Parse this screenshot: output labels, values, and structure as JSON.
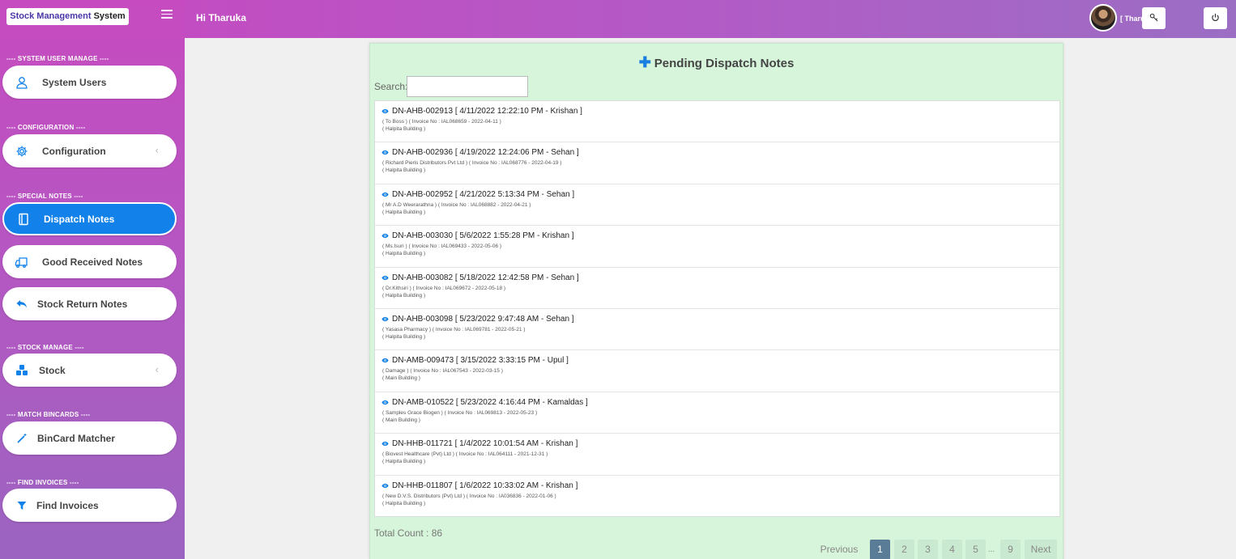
{
  "app": {
    "brand_part1": "Stock Management",
    "brand_part2": "System",
    "greeting": "Hi Tharuka",
    "username": "[ TharukaD ]"
  },
  "sidebar": {
    "sections": [
      {
        "title": "---- SYSTEM USER MANAGE ----"
      },
      {
        "title": "---- CONFIGURATION ----"
      },
      {
        "title": "---- SPECIAL NOTES ----"
      },
      {
        "title": "---- STOCK MANAGE ----"
      },
      {
        "title": "---- MATCH BINCARDS ----"
      },
      {
        "title": "---- FIND INVOICES ----"
      }
    ],
    "items": [
      {
        "label": "System Users",
        "icon": "user-icon"
      },
      {
        "label": "Configuration",
        "icon": "gear-icon"
      },
      {
        "label": "Dispatch Notes",
        "icon": "notebook-icon"
      },
      {
        "label": "Good Received Notes",
        "icon": "truck-icon"
      },
      {
        "label": "Stock Return Notes",
        "icon": "reply-icon"
      },
      {
        "label": "Stock",
        "icon": "boxes-icon"
      },
      {
        "label": "BinCard Matcher",
        "icon": "magic-wand-icon"
      },
      {
        "label": "Find Invoices",
        "icon": "filter-icon"
      }
    ]
  },
  "main": {
    "title": "Pending Dispatch Notes",
    "search_label": "Search:",
    "search_value": "",
    "total": "Total Count : 86",
    "notes": [
      {
        "head": "DN-AHB-002913 [ 4/11/2022 12:22:10 PM - Krishan ]",
        "sub": "( To Boss ) ( Invoice No : IAL068659 - 2022-04-11 )",
        "loc": "( Halpita Building )"
      },
      {
        "head": "DN-AHB-002936 [ 4/19/2022 12:24:06 PM - Sehan ]",
        "sub": "( Richard Pieris Distributors Pvt Ltd ) ( Invoice No : IAL068776 - 2022-04-19 )",
        "loc": "( Halpita Building )"
      },
      {
        "head": "DN-AHB-002952 [ 4/21/2022 5:13:34 PM - Sehan ]",
        "sub": "( Mr A.D Weerarathna ) ( Invoice No : IAL068882 - 2022-04-21 )",
        "loc": "( Halpita Building )"
      },
      {
        "head": "DN-AHB-003030 [ 5/6/2022 1:55:28 PM - Krishan ]",
        "sub": "( Ms.Isuri ) ( Invoice No : IAL069433 - 2022-05-06 )",
        "loc": "( Halpita Building )"
      },
      {
        "head": "DN-AHB-003082 [ 5/18/2022 12:42:58 PM - Sehan ]",
        "sub": "( Dr.Kithsiri ) ( Invoice No : IAL069672 - 2022-05-18 )",
        "loc": "( Halpita Building )"
      },
      {
        "head": "DN-AHB-003098 [ 5/23/2022 9:47:48 AM - Sehan ]",
        "sub": "( Yasasa Pharmacy ) ( Invoice No : IAL069781 - 2022-05-21 )",
        "loc": "( Halpita Building )"
      },
      {
        "head": "DN-AMB-009473 [ 3/15/2022 3:33:15 PM - Upul ]",
        "sub": "( Damage ) ( Invoice No : IAL067543 - 2022-03-15 )",
        "loc": "( Main Building )"
      },
      {
        "head": "DN-AMB-010522 [ 5/23/2022 4:16:44 PM - Kamaldas ]",
        "sub": "( Samples Grace Biogen ) ( Invoice No : IAL069813 - 2022-05-23 )",
        "loc": "( Main Building )"
      },
      {
        "head": "DN-HHB-011721 [ 1/4/2022 10:01:54 AM - Krishan ]",
        "sub": "( Biovest Healthcare (Pvt) Ltd ) ( Invoice No : IAL064111 - 2021-12-31 )",
        "loc": "( Halpita Building )"
      },
      {
        "head": "DN-HHB-011807 [ 1/6/2022 10:33:02 AM - Krishan ]",
        "sub": "( New D.V.S. Distributors (Pvt) Ltd ) ( Invoice No : IA036836 - 2022-01-06 )",
        "loc": "( Halpita Building )"
      }
    ],
    "pagination": {
      "previous": "Previous",
      "pages": [
        "1",
        "2",
        "3",
        "4",
        "5",
        "...",
        "9"
      ],
      "next": "Next",
      "current": "1"
    }
  },
  "colors": {
    "accent": "#1282ea",
    "panel_bg": "#d7f5da",
    "sidebar_top": "#c64bc0",
    "sidebar_bottom": "#9b64c0"
  }
}
